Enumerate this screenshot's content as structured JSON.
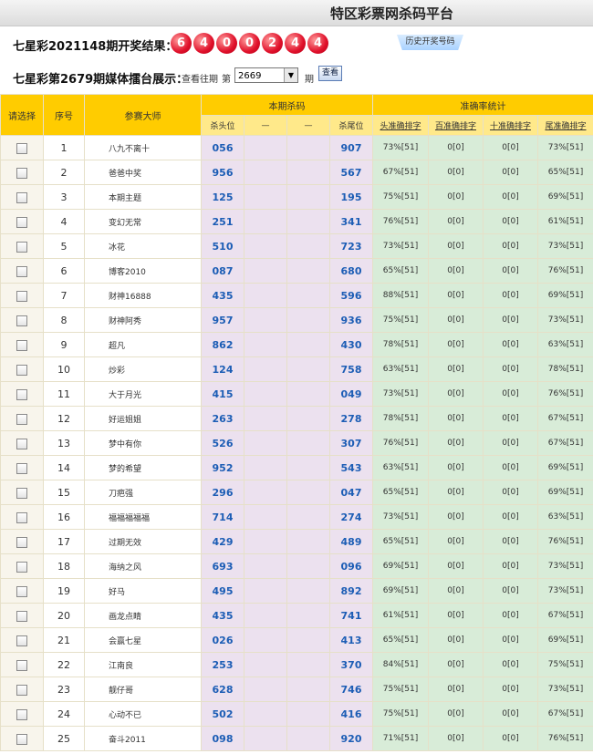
{
  "title": "特区彩票网杀码平台",
  "result": {
    "label": "七星彩2021148期开奖结果：",
    "balls": [
      "6",
      "4",
      "0",
      "0",
      "2",
      "4",
      "4"
    ],
    "tab_label": "历史开奖号码"
  },
  "arena": {
    "label": "七星彩第2679期媒体擂台展示：",
    "query_prefix": "查看往期",
    "query_mid": "第",
    "period_value": "2669",
    "period_suffix": "期",
    "go_label": "查看"
  },
  "table": {
    "headers": {
      "select": "请选择",
      "index": "序号",
      "expert": "参赛大师",
      "current_kill": "本期杀码",
      "accuracy": "准确率统计",
      "kill_head": "杀头位",
      "dash1": "—",
      "dash2": "—",
      "kill_tail": "杀尾位",
      "head_stat": "头准确排字",
      "hundred_stat": "百准确排字",
      "ten_stat": "十准确排字",
      "tail_stat": "尾准确排字"
    },
    "rows": [
      {
        "idx": "1",
        "name": "八九不离十",
        "head": "056",
        "tail": "907",
        "s1": "73%[51]",
        "s2": "0[0]",
        "s3": "0[0]",
        "s4": "73%[51]"
      },
      {
        "idx": "2",
        "name": "爸爸中奖",
        "head": "956",
        "tail": "567",
        "s1": "67%[51]",
        "s2": "0[0]",
        "s3": "0[0]",
        "s4": "65%[51]"
      },
      {
        "idx": "3",
        "name": "本期主题",
        "head": "125",
        "tail": "195",
        "s1": "75%[51]",
        "s2": "0[0]",
        "s3": "0[0]",
        "s4": "69%[51]"
      },
      {
        "idx": "4",
        "name": "变幻无常",
        "head": "251",
        "tail": "341",
        "s1": "76%[51]",
        "s2": "0[0]",
        "s3": "0[0]",
        "s4": "61%[51]"
      },
      {
        "idx": "5",
        "name": "冰花",
        "head": "510",
        "tail": "723",
        "s1": "73%[51]",
        "s2": "0[0]",
        "s3": "0[0]",
        "s4": "73%[51]"
      },
      {
        "idx": "6",
        "name": "博客2010",
        "head": "087",
        "tail": "680",
        "s1": "65%[51]",
        "s2": "0[0]",
        "s3": "0[0]",
        "s4": "76%[51]"
      },
      {
        "idx": "7",
        "name": "财神16888",
        "head": "435",
        "tail": "596",
        "s1": "88%[51]",
        "s2": "0[0]",
        "s3": "0[0]",
        "s4": "69%[51]"
      },
      {
        "idx": "8",
        "name": "财神阿秀",
        "head": "957",
        "tail": "936",
        "s1": "75%[51]",
        "s2": "0[0]",
        "s3": "0[0]",
        "s4": "73%[51]"
      },
      {
        "idx": "9",
        "name": "超凡",
        "head": "862",
        "tail": "430",
        "s1": "78%[51]",
        "s2": "0[0]",
        "s3": "0[0]",
        "s4": "63%[51]"
      },
      {
        "idx": "10",
        "name": "炒彩",
        "head": "124",
        "tail": "758",
        "s1": "63%[51]",
        "s2": "0[0]",
        "s3": "0[0]",
        "s4": "78%[51]"
      },
      {
        "idx": "11",
        "name": "大于月光",
        "head": "415",
        "tail": "049",
        "s1": "73%[51]",
        "s2": "0[0]",
        "s3": "0[0]",
        "s4": "76%[51]"
      },
      {
        "idx": "12",
        "name": "好运姐姐",
        "head": "263",
        "tail": "278",
        "s1": "78%[51]",
        "s2": "0[0]",
        "s3": "0[0]",
        "s4": "67%[51]"
      },
      {
        "idx": "13",
        "name": "梦中有你",
        "head": "526",
        "tail": "307",
        "s1": "76%[51]",
        "s2": "0[0]",
        "s3": "0[0]",
        "s4": "67%[51]"
      },
      {
        "idx": "14",
        "name": "梦的希望",
        "head": "952",
        "tail": "543",
        "s1": "63%[51]",
        "s2": "0[0]",
        "s3": "0[0]",
        "s4": "69%[51]"
      },
      {
        "idx": "15",
        "name": "刀疤强",
        "head": "296",
        "tail": "047",
        "s1": "65%[51]",
        "s2": "0[0]",
        "s3": "0[0]",
        "s4": "69%[51]"
      },
      {
        "idx": "16",
        "name": "福福福福福",
        "head": "714",
        "tail": "274",
        "s1": "73%[51]",
        "s2": "0[0]",
        "s3": "0[0]",
        "s4": "63%[51]"
      },
      {
        "idx": "17",
        "name": "过期无效",
        "head": "429",
        "tail": "489",
        "s1": "65%[51]",
        "s2": "0[0]",
        "s3": "0[0]",
        "s4": "76%[51]"
      },
      {
        "idx": "18",
        "name": "海纳之风",
        "head": "693",
        "tail": "096",
        "s1": "69%[51]",
        "s2": "0[0]",
        "s3": "0[0]",
        "s4": "73%[51]"
      },
      {
        "idx": "19",
        "name": "好马",
        "head": "495",
        "tail": "892",
        "s1": "69%[51]",
        "s2": "0[0]",
        "s3": "0[0]",
        "s4": "73%[51]"
      },
      {
        "idx": "20",
        "name": "画龙点睛",
        "head": "435",
        "tail": "741",
        "s1": "61%[51]",
        "s2": "0[0]",
        "s3": "0[0]",
        "s4": "67%[51]"
      },
      {
        "idx": "21",
        "name": "会赢七星",
        "head": "026",
        "tail": "413",
        "s1": "65%[51]",
        "s2": "0[0]",
        "s3": "0[0]",
        "s4": "69%[51]"
      },
      {
        "idx": "22",
        "name": "江南良",
        "head": "253",
        "tail": "370",
        "s1": "84%[51]",
        "s2": "0[0]",
        "s3": "0[0]",
        "s4": "75%[51]"
      },
      {
        "idx": "23",
        "name": "靓仔哥",
        "head": "628",
        "tail": "746",
        "s1": "75%[51]",
        "s2": "0[0]",
        "s3": "0[0]",
        "s4": "73%[51]"
      },
      {
        "idx": "24",
        "name": "心动不已",
        "head": "502",
        "tail": "416",
        "s1": "75%[51]",
        "s2": "0[0]",
        "s3": "0[0]",
        "s4": "67%[51]"
      },
      {
        "idx": "25",
        "name": "奋斗2011",
        "head": "098",
        "tail": "920",
        "s1": "71%[51]",
        "s2": "0[0]",
        "s3": "0[0]",
        "s4": "76%[51]"
      }
    ]
  }
}
